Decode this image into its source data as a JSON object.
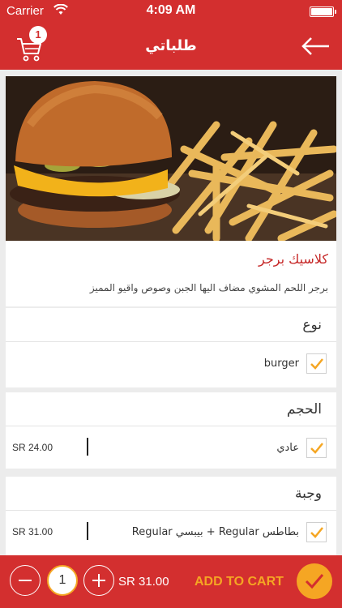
{
  "status_bar": {
    "carrier": "Carrier",
    "time": "4:09 AM"
  },
  "nav": {
    "title": "طلباتي",
    "cart_count": "1"
  },
  "product": {
    "name": "كلاسيك برجر",
    "description": "برجر اللحم المشوي مضاف اليها الجبن وصوص واقيو المميز"
  },
  "sections": [
    {
      "title": "نوع",
      "option": {
        "label": "burger",
        "price": "",
        "checked": true
      }
    },
    {
      "title": "الحجم",
      "option": {
        "label": "عادي",
        "price": "SR 24.00",
        "checked": true
      }
    },
    {
      "title": "وجبة",
      "option": {
        "label": "بطاطس Regular + بيبسي Regular",
        "price": "SR 31.00",
        "checked": true
      }
    }
  ],
  "bottom_bar": {
    "quantity": "1",
    "total": "SR 31.00",
    "add_to_cart_label": "ADD TO CART"
  },
  "colors": {
    "primary": "#d32f2f",
    "accent": "#f5a623",
    "background": "#ececec"
  },
  "icons": [
    "wifi-icon",
    "battery-icon",
    "cart-icon",
    "back-arrow-icon",
    "check-icon",
    "minus-icon",
    "plus-icon"
  ]
}
